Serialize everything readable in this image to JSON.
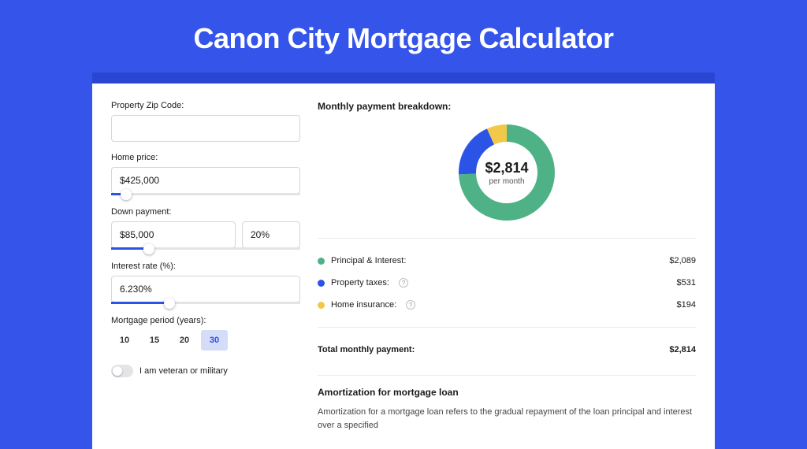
{
  "title": "Canon City Mortgage Calculator",
  "form": {
    "zip": {
      "label": "Property Zip Code:",
      "value": ""
    },
    "home_price": {
      "label": "Home price:",
      "value": "$425,000",
      "slider_pct": 8
    },
    "down_payment": {
      "label": "Down payment:",
      "amount": "$85,000",
      "percent": "20%",
      "slider_pct": 20
    },
    "interest": {
      "label": "Interest rate (%):",
      "value": "6.230%",
      "slider_pct": 31
    },
    "period": {
      "label": "Mortgage period (years):",
      "options": [
        "10",
        "15",
        "20",
        "30"
      ],
      "selected": "30"
    },
    "veteran": {
      "label": "I am veteran or military",
      "checked": false
    }
  },
  "breakdown": {
    "title": "Monthly payment breakdown:",
    "center_amount": "$2,814",
    "center_label": "per month",
    "items": [
      {
        "label": "Principal & Interest:",
        "value": "$2,089",
        "color": "#4fb286",
        "info": false
      },
      {
        "label": "Property taxes:",
        "value": "$531",
        "color": "#2b53e6",
        "info": true
      },
      {
        "label": "Home insurance:",
        "value": "$194",
        "color": "#f2c84b",
        "info": true
      }
    ],
    "total": {
      "label": "Total monthly payment:",
      "value": "$2,814"
    }
  },
  "amort": {
    "title": "Amortization for mortgage loan",
    "body": "Amortization for a mortgage loan refers to the gradual repayment of the loan principal and interest over a specified"
  },
  "chart_data": {
    "type": "pie",
    "title": "Monthly payment breakdown",
    "series": [
      {
        "name": "Principal & Interest",
        "value": 2089,
        "color": "#4fb286"
      },
      {
        "name": "Property taxes",
        "value": 531,
        "color": "#2b53e6"
      },
      {
        "name": "Home insurance",
        "value": 194,
        "color": "#f2c84b"
      }
    ],
    "total": 2814,
    "center_text": "$2,814 per month"
  }
}
